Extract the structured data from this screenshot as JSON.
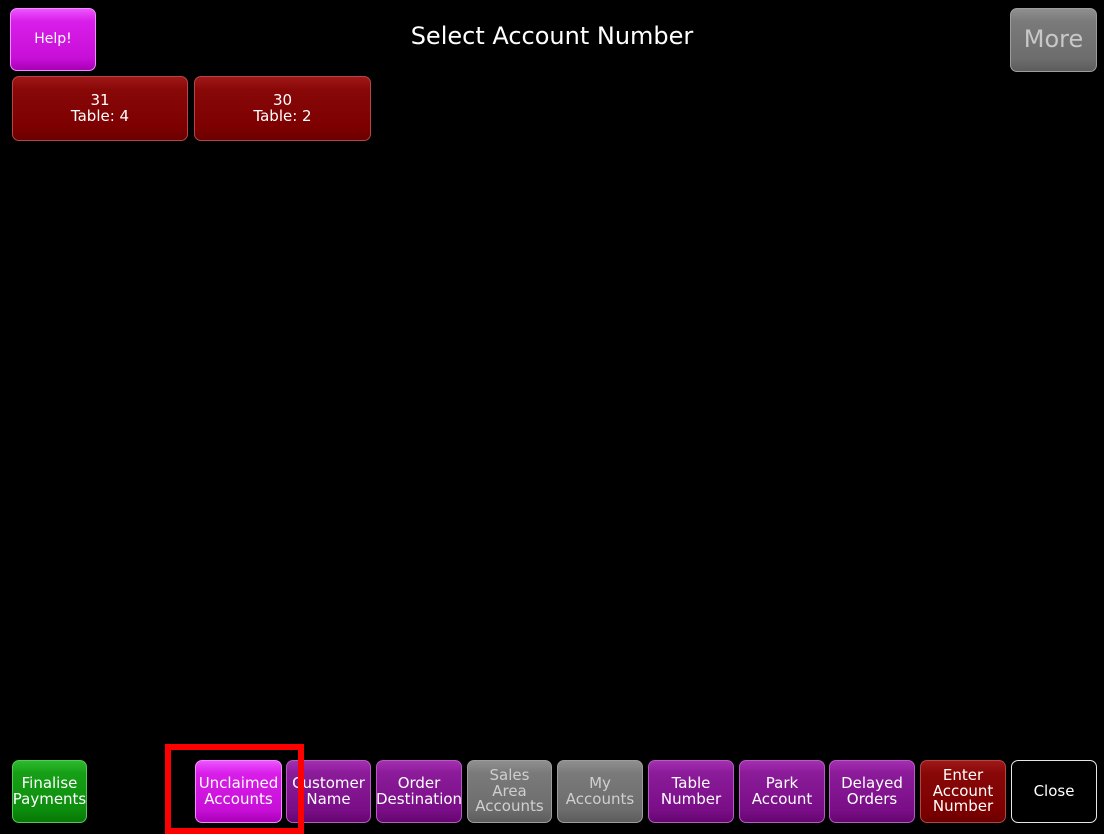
{
  "header": {
    "help_label": "Help!",
    "title": "Select Account Number",
    "more_label": "More"
  },
  "accounts": [
    {
      "label": "31\nTable: 4"
    },
    {
      "label": "30\nTable: 2"
    }
  ],
  "bottom_bar": {
    "finalise_payments": "Finalise\nPayments",
    "unclaimed_accounts": "Unclaimed\nAccounts",
    "customer_name": "Customer\nName",
    "order_destination": "Order\nDestination",
    "sales_area_accounts": "Sales\nArea\nAccounts",
    "my_accounts": "My\nAccounts",
    "table_number": "Table\nNumber",
    "park_account": "Park\nAccount",
    "delayed_orders": "Delayed\nOrders",
    "enter_account_number": "Enter\nAccount\nNumber",
    "close": "Close"
  },
  "colors": {
    "background": "#000000",
    "purple": "#7a0e87",
    "magenta": "#c80fd8",
    "grey": "#6d6d6d",
    "green": "#0d8d0d",
    "dark_red": "#7d0000",
    "highlight": "#ff0000"
  }
}
